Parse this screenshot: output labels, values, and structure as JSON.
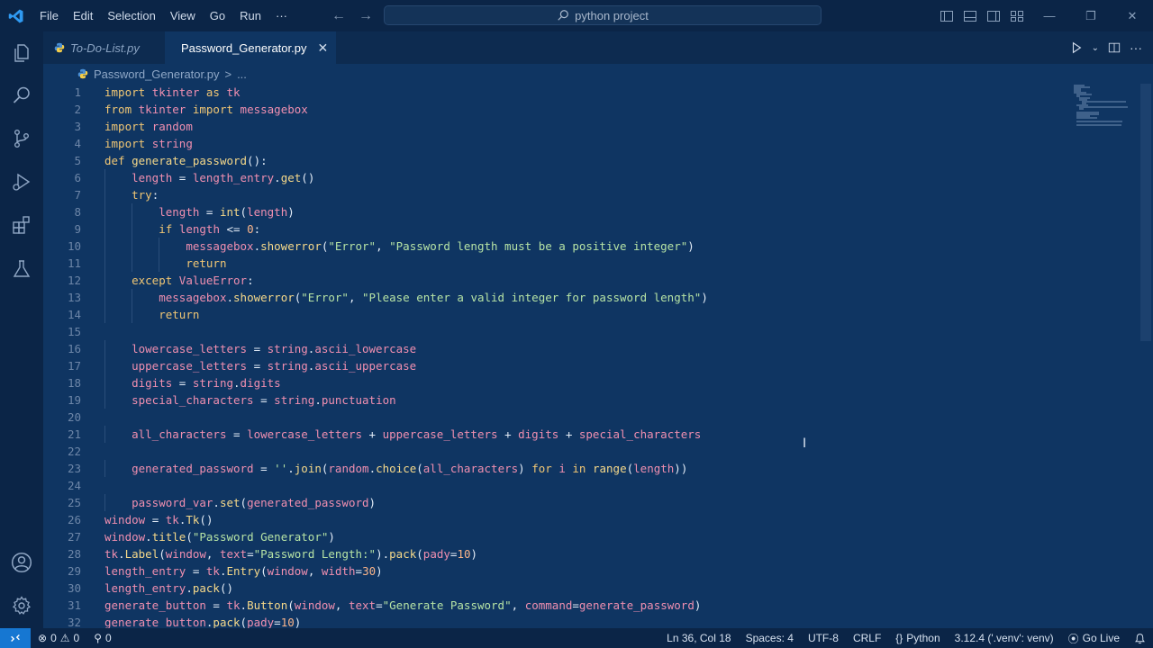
{
  "titlebar": {
    "menu": [
      "File",
      "Edit",
      "Selection",
      "View",
      "Go",
      "Run",
      "···"
    ],
    "search_text": "python project"
  },
  "tabs": [
    {
      "label": "To-Do-List.py",
      "active": false
    },
    {
      "label": "Password_Generator.py",
      "active": true
    }
  ],
  "breadcrumb": {
    "file": "Password_Generator.py",
    "sep": ">",
    "more": "..."
  },
  "editor": {
    "line_numbers": [
      "1",
      "2",
      "3",
      "4",
      "5",
      "6",
      "7",
      "8",
      "9",
      "10",
      "11",
      "12",
      "13",
      "14",
      "15",
      "16",
      "17",
      "18",
      "19",
      "20",
      "21",
      "22",
      "23",
      "24",
      "25",
      "26",
      "27",
      "28",
      "29",
      "30",
      "31",
      "32"
    ],
    "lines": [
      "import tkinter as tk",
      "from tkinter import messagebox",
      "import random",
      "import string",
      "def generate_password():",
      "    length = length_entry.get()",
      "    try:",
      "        length = int(length)",
      "        if length <= 0:",
      "            messagebox.showerror(\"Error\", \"Password length must be a positive integer\")",
      "            return",
      "    except ValueError:",
      "        messagebox.showerror(\"Error\", \"Please enter a valid integer for password length\")",
      "        return",
      "",
      "    lowercase_letters = string.ascii_lowercase",
      "    uppercase_letters = string.ascii_uppercase",
      "    digits = string.digits",
      "    special_characters = string.punctuation",
      "",
      "    all_characters = lowercase_letters + uppercase_letters + digits + special_characters",
      "",
      "    generated_password = ''.join(random.choice(all_characters) for i in range(length))",
      "",
      "    password_var.set(generated_password)",
      "window = tk.Tk()",
      "window.title(\"Password Generator\")",
      "tk.Label(window, text=\"Password Length:\").pack(pady=10)",
      "length_entry = tk.Entry(window, width=30)",
      "length_entry.pack()",
      "generate_button = tk.Button(window, text=\"Generate Password\", command=generate_password)",
      "generate_button.pack(pady=10)"
    ]
  },
  "statusbar": {
    "errors": "0",
    "warnings": "0",
    "ports": "0",
    "position": "Ln 36, Col 18",
    "spaces": "Spaces: 4",
    "encoding": "UTF-8",
    "eol": "CRLF",
    "language": "Python",
    "interpreter": "3.12.4 ('.venv': venv)",
    "go_live": "Go Live"
  },
  "colors": {
    "editor_bg": "#0f3562",
    "chrome_bg": "#0b2547",
    "remote_accent": "#1677d2",
    "keyword": "#f0c674",
    "string": "#b6e3a5",
    "identifier": "#f08fb0"
  },
  "icons": {
    "activity": [
      "explorer-icon",
      "search-icon",
      "source-control-icon",
      "run-debug-icon",
      "extensions-icon",
      "testing-icon",
      "account-icon",
      "settings-gear-icon"
    ]
  }
}
